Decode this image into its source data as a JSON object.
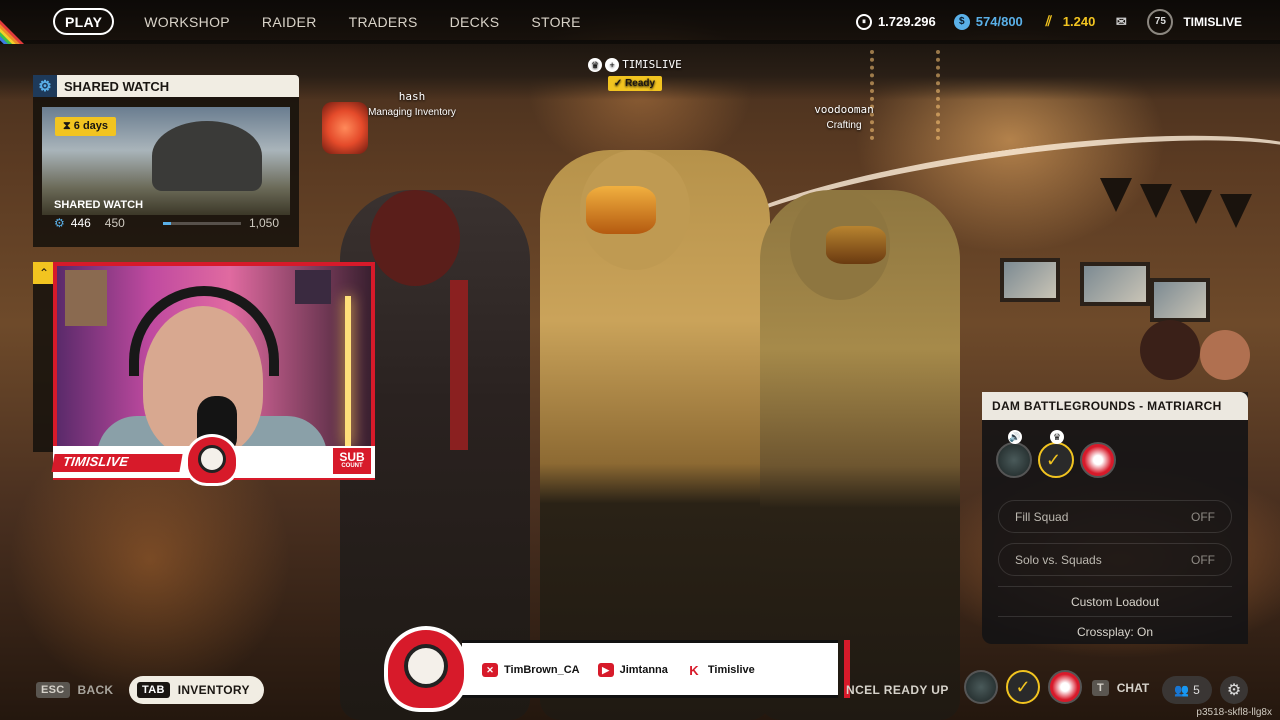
{
  "nav": {
    "items": [
      {
        "label": "PLAY",
        "active": true
      },
      {
        "label": "WORKSHOP"
      },
      {
        "label": "RAIDER"
      },
      {
        "label": "TRADERS"
      },
      {
        "label": "DECKS"
      },
      {
        "label": "STORE"
      }
    ]
  },
  "currencies": {
    "coins": "1.729.296",
    "raider_tokens": "574/800",
    "cred": "1.240",
    "level": "75",
    "username": "TIMISLIVE"
  },
  "shared_watch": {
    "header": "SHARED WATCH",
    "badge": "6 days",
    "title": "SHARED WATCH",
    "current": "446",
    "next": "450",
    "max": "1,050",
    "progress_fraction": 0.1
  },
  "webcam": {
    "name": "TIMISLIVE",
    "sub_line1": "SUB",
    "sub_line2": "COUNT"
  },
  "squad": {
    "leader": {
      "name": "TIMISLIVE",
      "status": "Ready"
    },
    "left": {
      "name": "hash",
      "status": "Managing Inventory"
    },
    "right": {
      "name": "voodooman",
      "status": "Crafting"
    }
  },
  "lobby": {
    "map": "DAM BATTLEGROUNDS - MATRIARCH",
    "fill_squad": {
      "label": "Fill Squad",
      "value": "OFF"
    },
    "solo_vs_squads": {
      "label": "Solo vs. Squads",
      "value": "OFF"
    },
    "custom_loadout": "Custom Loadout",
    "crossplay": "Crossplay: On"
  },
  "bottom": {
    "back_key": "ESC",
    "back_label": "BACK",
    "inv_key": "TAB",
    "inv_label": "INVENTORY",
    "cancel_label": "NCEL READY UP",
    "chat_key": "T",
    "chat_label": "CHAT",
    "friends_count": "5",
    "build": "p3518-skfl8-llg8x"
  },
  "socials": [
    {
      "icon": "x-icon",
      "handle": "TimBrown_CA"
    },
    {
      "icon": "youtube-icon",
      "handle": "Jimtanna"
    },
    {
      "icon": "kick-icon",
      "handle": "Timislive"
    }
  ],
  "colors": {
    "accent_yellow": "#f2c420",
    "brand_red": "#d71a2a",
    "watch_blue": "#5ab0e8"
  }
}
